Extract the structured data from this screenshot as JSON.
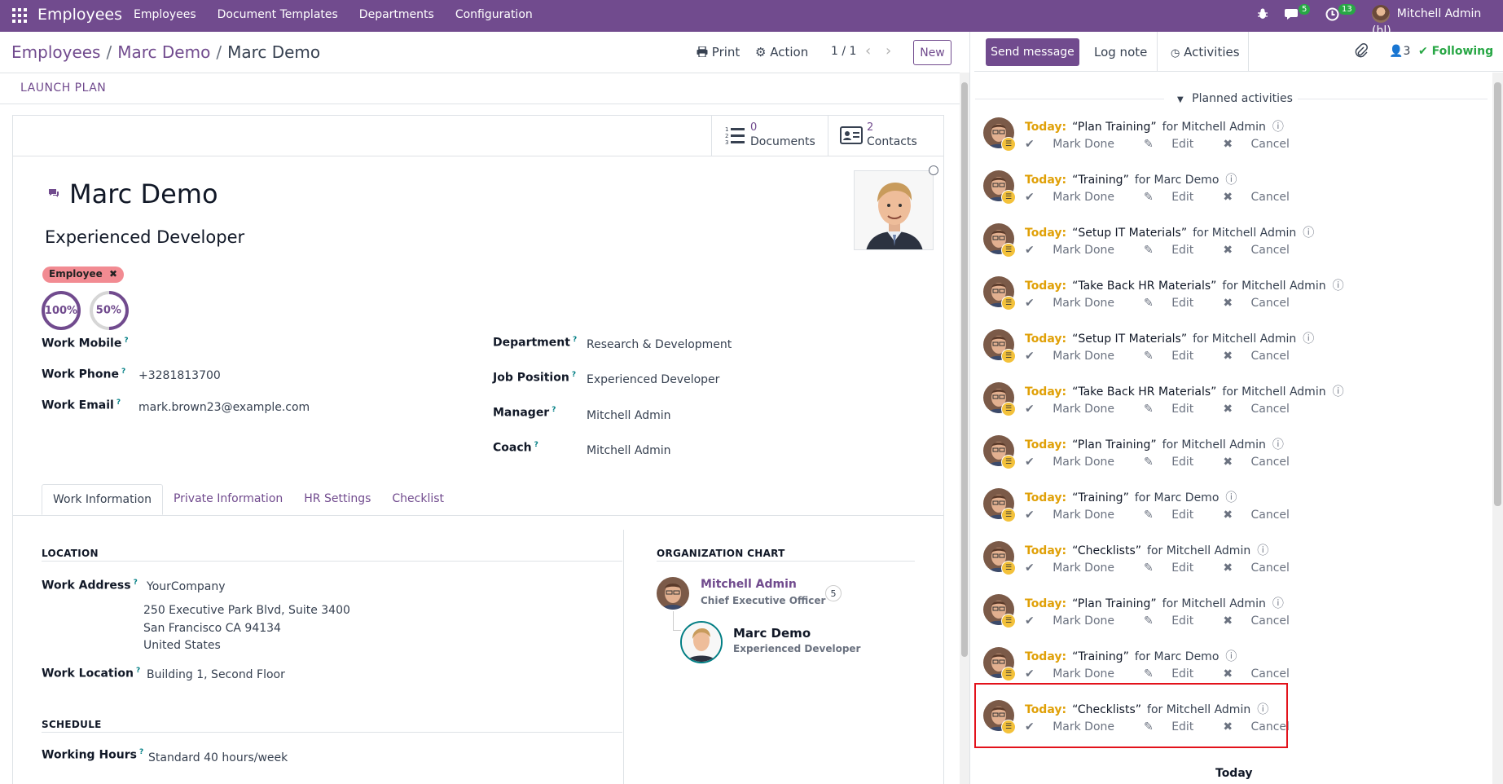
{
  "navbar": {
    "brand": "Employees",
    "menu": [
      "Employees",
      "Document Templates",
      "Departments",
      "Configuration"
    ],
    "messages_count": "5",
    "activities_count": "13",
    "user_name": "Mitchell Admin (hl)"
  },
  "breadcrumb": {
    "root": "Employees",
    "middle": "Marc Demo",
    "current": "Marc Demo"
  },
  "control": {
    "print_label": "Print",
    "action_label": "Action",
    "pager": "1 / 1",
    "new_label": "New",
    "launch_plan": "LAUNCH PLAN"
  },
  "smart_buttons": [
    {
      "count": "0",
      "label": "Documents"
    },
    {
      "count": "2",
      "label": "Contacts"
    }
  ],
  "employee": {
    "name": "Marc Demo",
    "job_title": "Experienced Developer",
    "tag": "Employee",
    "progress": [
      {
        "label": "100%",
        "value": 1.0
      },
      {
        "label": "50%",
        "value": 0.5
      }
    ]
  },
  "fields_left": [
    {
      "label": "Work Mobile",
      "value": ""
    },
    {
      "label": "Work Phone",
      "value": "+3281813700"
    },
    {
      "label": "Work Email",
      "value": "mark.brown23@example.com"
    }
  ],
  "fields_right": [
    {
      "label": "Department",
      "value": "Research & Development"
    },
    {
      "label": "Job Position",
      "value": "Experienced Developer"
    },
    {
      "label": "Manager",
      "value": "Mitchell Admin"
    },
    {
      "label": "Coach",
      "value": "Mitchell Admin"
    }
  ],
  "tabs": [
    "Work Information",
    "Private Information",
    "HR Settings",
    "Checklist"
  ],
  "location": {
    "title": "LOCATION",
    "work_address_label": "Work Address",
    "company": "YourCompany",
    "street": "250 Executive Park Blvd, Suite 3400",
    "city": "San Francisco CA 94134",
    "country": "United States",
    "work_location_label": "Work Location",
    "work_location": "Building 1, Second Floor"
  },
  "schedule": {
    "title": "SCHEDULE",
    "working_hours_label": "Working Hours",
    "working_hours": "Standard 40 hours/week"
  },
  "org_chart": {
    "title": "ORGANIZATION CHART",
    "manager_name": "Mitchell Admin",
    "manager_title": "Chief Executive Officer",
    "manager_count": "5",
    "employee_name": "Marc Demo",
    "employee_title": "Experienced Developer"
  },
  "chatter": {
    "send_message": "Send message",
    "log_note": "Log note",
    "activities": "Activities",
    "followers_count": "3",
    "following": "Following",
    "planned_header": "Planned activities",
    "footer_today": "Today",
    "today_label": "Today:",
    "action_mark_done": "Mark Done",
    "action_edit": "Edit",
    "action_cancel": "Cancel",
    "activities_list": [
      {
        "title": "“Plan Training”",
        "for": "for Mitchell Admin"
      },
      {
        "title": "“Training”",
        "for": "for Marc Demo"
      },
      {
        "title": "“Setup IT Materials”",
        "for": "for Mitchell Admin"
      },
      {
        "title": "“Take Back HR Materials”",
        "for": "for Mitchell Admin"
      },
      {
        "title": "“Setup IT Materials”",
        "for": "for Mitchell Admin"
      },
      {
        "title": "“Take Back HR Materials”",
        "for": "for Mitchell Admin"
      },
      {
        "title": "“Plan Training”",
        "for": "for Mitchell Admin"
      },
      {
        "title": "“Training”",
        "for": "for Marc Demo"
      },
      {
        "title": "“Checklists”",
        "for": "for Mitchell Admin"
      },
      {
        "title": "“Plan Training”",
        "for": "for Mitchell Admin"
      },
      {
        "title": "“Training”",
        "for": "for Marc Demo"
      },
      {
        "title": "“Checklists”",
        "for": "for Mitchell Admin"
      }
    ]
  },
  "colors": {
    "brand": "#714b8e",
    "today": "#e0a007",
    "following": "#28a745",
    "tag": "#f28b92",
    "highlight": "#e3121b"
  }
}
